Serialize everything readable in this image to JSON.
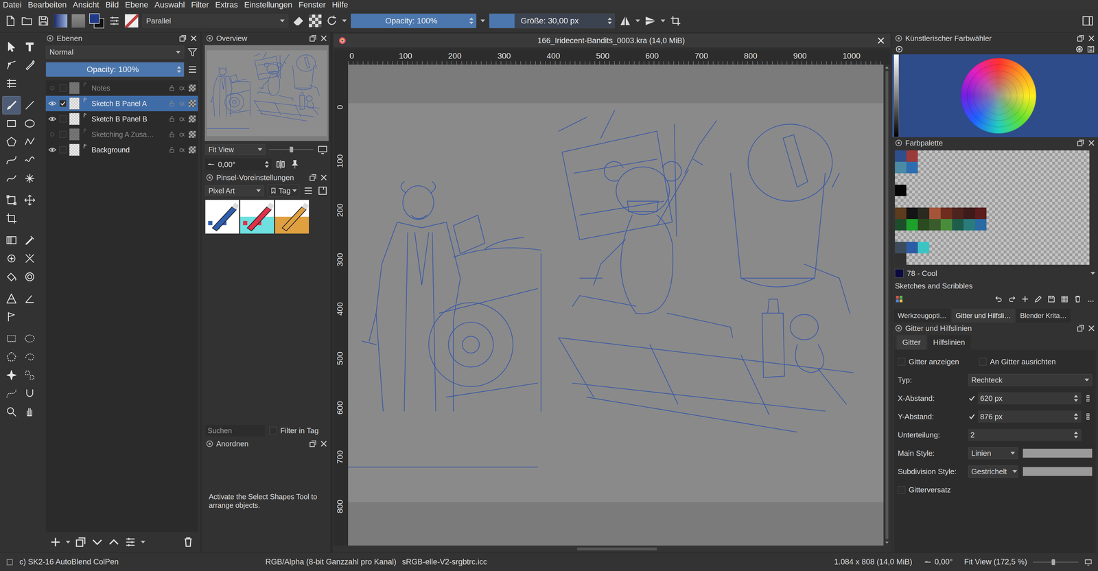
{
  "window": {
    "title": "166_Iridecent-Bandits_0003.kra (14,0 MiB)"
  },
  "menu": [
    "Datei",
    "Bearbeiten",
    "Ansicht",
    "Bild",
    "Ebene",
    "Auswahl",
    "Filter",
    "Extras",
    "Einstellungen",
    "Fenster",
    "Hilfe"
  ],
  "toolbar": {
    "blend_mode": "Parallel",
    "opacity": {
      "label": "Opacity: 100%",
      "level": 1
    },
    "size": {
      "label": "Größe: 30,00 px",
      "level": 0.2
    }
  },
  "toolbox": {
    "tools": [
      {
        "selected": false
      },
      {
        "selected": false
      },
      {
        "selected": false
      },
      {
        "selected": false
      },
      {
        "selected": false
      },
      {
        "selected": true
      },
      {
        "selected": false
      },
      {
        "selected": false
      },
      {
        "selected": false
      },
      {
        "selected": false
      },
      {
        "selected": false
      },
      {
        "selected": false
      },
      {
        "selected": false
      },
      {
        "selected": false
      },
      {
        "selected": false
      },
      {
        "selected": false
      },
      {
        "selected": false
      },
      {
        "selected": false
      },
      {
        "selected": false
      },
      {
        "selected": false
      },
      {
        "selected": false
      },
      {
        "selected": false
      },
      {
        "selected": false
      },
      {
        "selected": false
      },
      {
        "selected": false
      },
      {
        "selected": false
      },
      {
        "selected": false
      },
      {
        "selected": false
      },
      {
        "selected": false
      },
      {
        "selected": false
      },
      {
        "selected": false
      },
      {
        "selected": false
      },
      {
        "selected": false
      },
      {
        "selected": false
      },
      {
        "selected": false
      },
      {
        "selected": false
      },
      {
        "selected": false
      }
    ]
  },
  "layers_docker": {
    "title": "Ebenen",
    "blend_mode": "Normal",
    "opacity": {
      "label": "Opacity: 100%",
      "level": 1
    },
    "layers": [
      {
        "name": "Notes",
        "visible": false,
        "selected": false,
        "checked": false
      },
      {
        "name": "Sketch B Panel A",
        "visible": true,
        "selected": true,
        "checked": true
      },
      {
        "name": "Sketch B Panel B",
        "visible": true,
        "selected": false,
        "checked": false
      },
      {
        "name": "Sketching A Zusa…",
        "visible": false,
        "selected": false,
        "checked": false
      },
      {
        "name": "Background",
        "visible": true,
        "selected": false,
        "checked": false
      }
    ]
  },
  "overview": {
    "title": "Overview",
    "zoom_mode": "Fit View",
    "zoom_level": 0.5,
    "rotation": "0,00°"
  },
  "brush_presets": {
    "title": "Pinsel-Voreinstellungen",
    "tag": "Pixel Art",
    "tag_button": "Tag",
    "search_placeholder": "Suchen",
    "filter": {
      "label": "Filter in Tag",
      "checked": false
    },
    "presets": [
      {
        "color": "#2f5fb0"
      },
      {
        "color": "#e0304a"
      },
      {
        "color": "#e0a040"
      }
    ]
  },
  "arrange": {
    "title": "Anordnen",
    "message": "Activate the Select Shapes Tool to arrange objects."
  },
  "document": {
    "title": "166_Iridecent-Bandits_0003.kra (14,0 MiB)",
    "ruler_x": [
      "0",
      "100",
      "200",
      "300",
      "400",
      "500",
      "600",
      "700",
      "800",
      "900",
      "1000"
    ],
    "ruler_y": [
      "0",
      "100",
      "200",
      "300",
      "400",
      "500",
      "600",
      "700",
      "800"
    ]
  },
  "color_selector": {
    "title": "Künstlerischer Farbwähler"
  },
  "palette": {
    "title": "Farbpalette",
    "rows": [
      [
        "#2e4f8c",
        "#9a3a3a"
      ],
      [
        "#4a8aa4",
        "#2d6db0"
      ],
      [],
      [
        "#050505"
      ],
      [],
      [
        "#5c3b1e",
        "#141414",
        "#2a2a20",
        "#a5543a",
        "#6e2d1e",
        "#4d231d",
        "#3d1b1b",
        "#5a1c1c"
      ],
      [
        "#1e4d2c",
        "#1ea02c",
        "#2a4a20",
        "#3a5c2c",
        "#4a8c3c",
        "#1e5c4c",
        "#2a7c7c",
        "#2a6aa4"
      ],
      [],
      [
        "#3c4c5c",
        "#2c5ca4",
        "#3cc4c4"
      ],
      [
        "#303030"
      ]
    ],
    "current": {
      "name": "78 - Cool",
      "color": "#0a0a40"
    },
    "group": "Sketches and Scribbles"
  },
  "dock_tabs": [
    {
      "label": "Werkzeugopti…",
      "selected": false
    },
    {
      "label": "Gitter und Hilfsli…",
      "selected": true
    },
    {
      "label": "Blender Krita…",
      "selected": false
    }
  ],
  "grid_docker": {
    "title": "Gitter und Hilfslinien",
    "tabs": [
      {
        "label": "Gitter",
        "selected": true
      },
      {
        "label": "Hilfslinien",
        "selected": false
      }
    ],
    "show_grid": {
      "label": "Gitter anzeigen",
      "checked": false
    },
    "snap": {
      "label": "An Gitter ausrichten",
      "checked": false
    },
    "fields": [
      {
        "label": "Typ:",
        "value": "Rechteck",
        "kind": "dropdown",
        "checked": false,
        "color": ""
      },
      {
        "label": "X-Abstand:",
        "value": "620 px",
        "kind": "spin",
        "checked": true,
        "color": ""
      },
      {
        "label": "Y-Abstand:",
        "value": "876 px",
        "kind": "spin",
        "checked": true,
        "color": ""
      },
      {
        "label": "Unterteilung:",
        "value": "2",
        "kind": "plain",
        "checked": false,
        "color": ""
      },
      {
        "label": "Main Style:",
        "value": "Linien",
        "kind": "style",
        "checked": false,
        "color": "#9a9a9a"
      },
      {
        "label": "Subdivision Style:",
        "value": "Gestrichelt",
        "kind": "style",
        "checked": false,
        "color": "#9a9a9a"
      }
    ],
    "offset": {
      "label": "Gitterversatz",
      "checked": false
    }
  },
  "status_bar": {
    "brush": "c) SK2-16 AutoBlend ColPen",
    "color_space": "RGB/Alpha (8-bit Ganzzahl pro Kanal)",
    "profile": "sRGB-elle-V2-srgbtrc.icc",
    "size": "1.084 x 808 (14,0 MiB)",
    "rotation": "0,00°",
    "zoom": "Fit View (172,5 %)",
    "zoom_level": 0.45
  }
}
